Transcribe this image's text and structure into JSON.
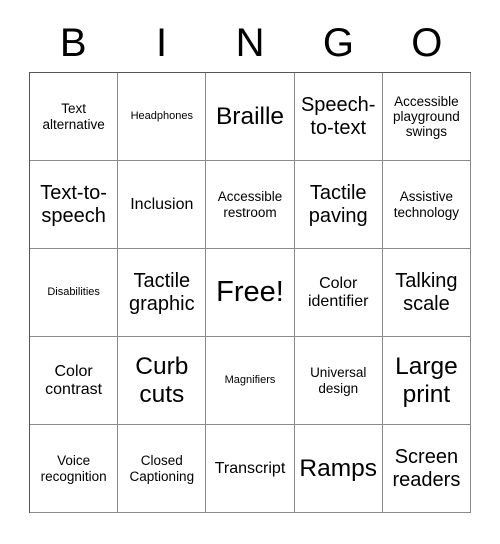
{
  "card": {
    "header_letters": [
      "B",
      "I",
      "N",
      "G",
      "O"
    ],
    "rows": [
      [
        {
          "text": "Text alternative",
          "size": "sm"
        },
        {
          "text": "Headphones",
          "size": "xs"
        },
        {
          "text": "Braille",
          "size": "xl"
        },
        {
          "text": "Speech-to-text",
          "size": "lg"
        },
        {
          "text": "Accessible playground swings",
          "size": "sm"
        }
      ],
      [
        {
          "text": "Text-to-speech",
          "size": "lg"
        },
        {
          "text": "Inclusion",
          "size": "md"
        },
        {
          "text": "Accessible restroom",
          "size": "sm"
        },
        {
          "text": "Tactile paving",
          "size": "lg"
        },
        {
          "text": "Assistive technology",
          "size": "sm"
        }
      ],
      [
        {
          "text": "Disabilities",
          "size": "xs"
        },
        {
          "text": "Tactile graphic",
          "size": "lg"
        },
        {
          "text": "Free!",
          "size": "xxl"
        },
        {
          "text": "Color identifier",
          "size": "md"
        },
        {
          "text": "Talking scale",
          "size": "lg"
        }
      ],
      [
        {
          "text": "Color contrast",
          "size": "md"
        },
        {
          "text": "Curb cuts",
          "size": "xl"
        },
        {
          "text": "Magnifiers",
          "size": "xs"
        },
        {
          "text": "Universal design",
          "size": "sm"
        },
        {
          "text": "Large print",
          "size": "xl"
        }
      ],
      [
        {
          "text": "Voice recognition",
          "size": "sm"
        },
        {
          "text": "Closed Captioning",
          "size": "sm"
        },
        {
          "text": "Transcript",
          "size": "md"
        },
        {
          "text": "Ramps",
          "size": "xl"
        },
        {
          "text": "Screen readers",
          "size": "lg"
        }
      ]
    ]
  },
  "colors": {
    "background": "#ffffff",
    "text": "#000000",
    "border": "#8a8a8a",
    "border_outer": "#555555"
  }
}
